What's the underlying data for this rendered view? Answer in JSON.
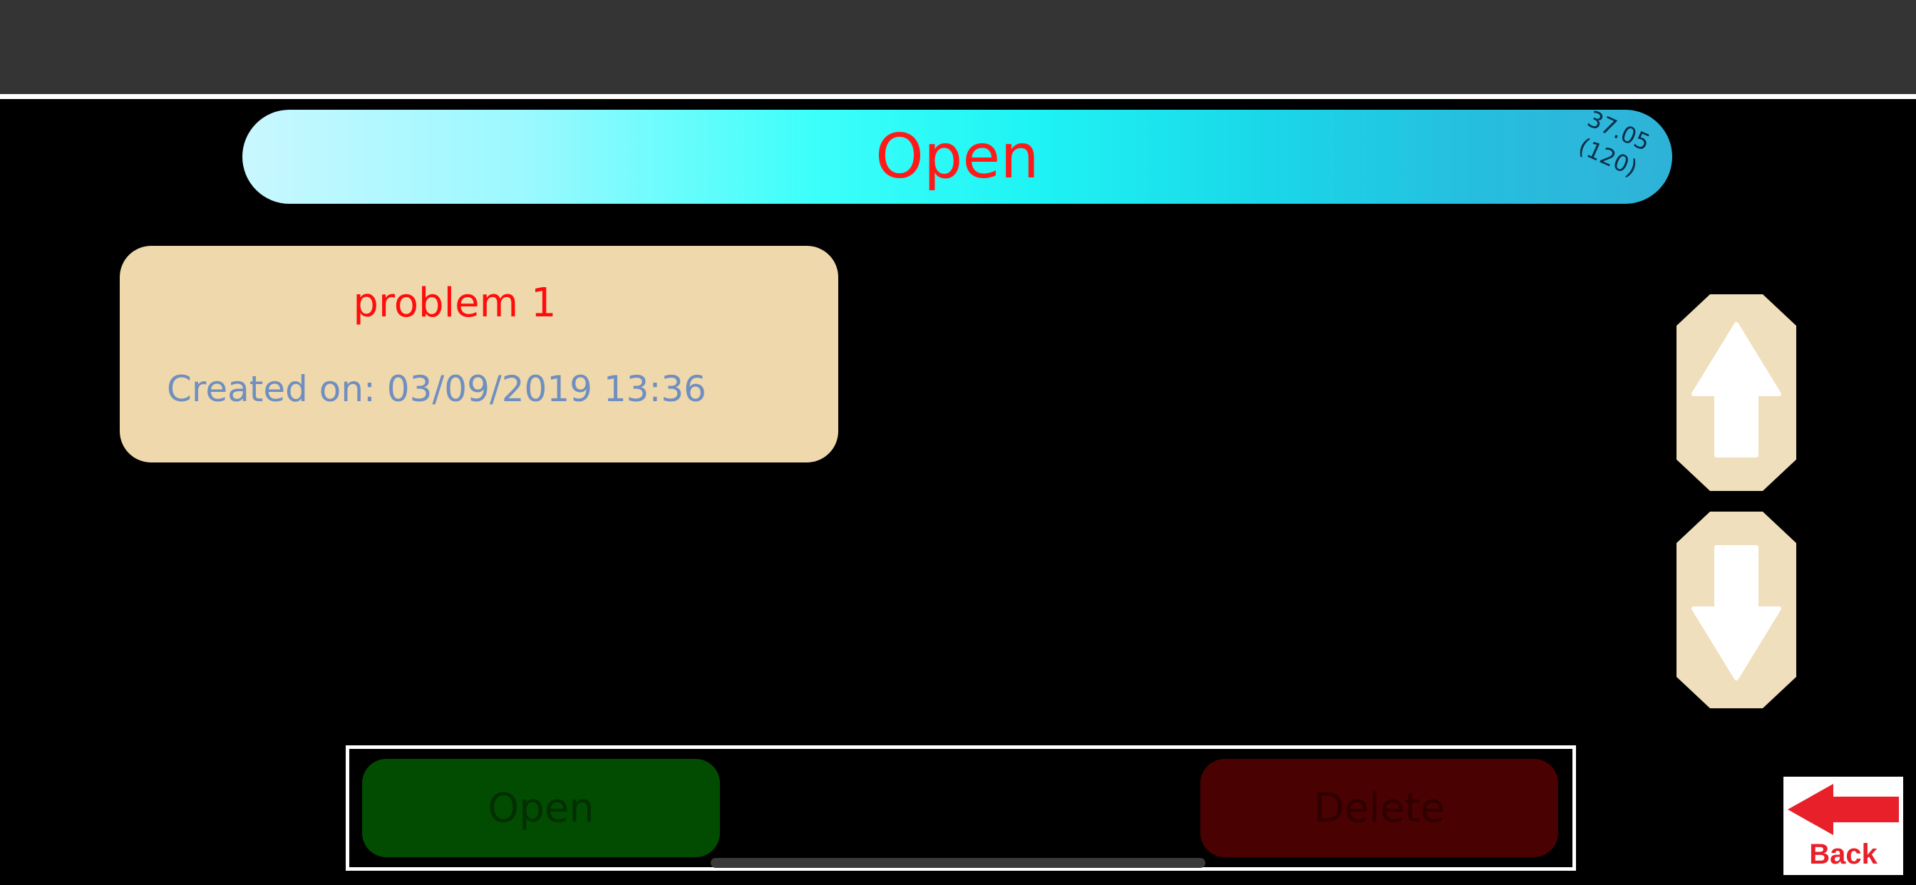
{
  "header": {
    "title": "Open"
  },
  "stamp": {
    "line1": "37.05",
    "line2": "(120)"
  },
  "list": {
    "items": [
      {
        "name": "problem 1",
        "created": "Created on: 03/09/2019 13:36"
      }
    ]
  },
  "scroll": {
    "up_icon": "arrow-up-icon",
    "down_icon": "arrow-down-icon"
  },
  "actions": {
    "open_label": "Open",
    "delete_label": "Delete"
  },
  "back": {
    "label": "Back",
    "icon": "arrow-left-icon"
  },
  "colors": {
    "title_text": "#ff1a1a",
    "card_bg": "#efd8ac",
    "item_name": "#ff0d0d",
    "item_date": "#6f8fbf",
    "open_bg": "#024c01",
    "delete_bg": "#4a0101",
    "back_red": "#e8202a"
  }
}
